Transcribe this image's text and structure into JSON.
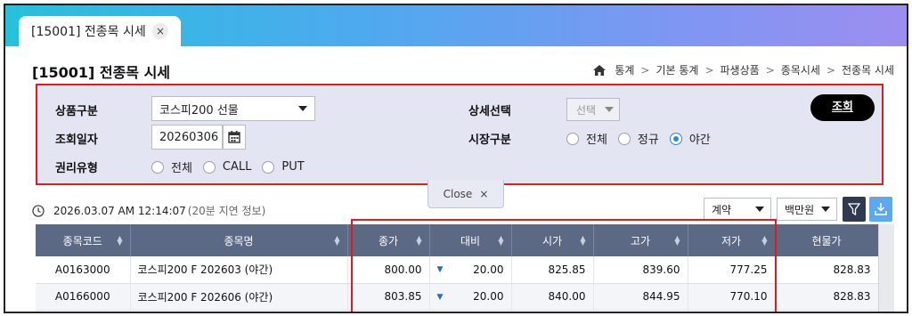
{
  "tab": {
    "label": "[15001] 전종목 시세",
    "close": "×"
  },
  "page": {
    "title": "[15001] 전종목 시세"
  },
  "breadcrumb": [
    "통계",
    "기본 통계",
    "파생상품",
    "종목시세",
    "전종목 시세"
  ],
  "search": {
    "product_label": "상품구분",
    "product_value": "코스피200 선물",
    "date_label": "조회일자",
    "date_value": "20260306",
    "right_label": "권리유형",
    "right_options": [
      "전체",
      "CALL",
      "PUT"
    ],
    "detail_label": "상세선택",
    "detail_value": "선택",
    "market_label": "시장구분",
    "market_options": [
      "전체",
      "정규",
      "야간"
    ],
    "market_selected": "야간",
    "button": "조회"
  },
  "close_panel": {
    "label": "Close",
    "icon": "×"
  },
  "status": {
    "time": "2026.03.07 AM 12:14:07",
    "note": "(20분 지연 정보)"
  },
  "controls": {
    "sort_select": "계약",
    "unit_select": "백만원"
  },
  "icons": {
    "filter": "filter-icon",
    "download": "download-icon",
    "calendar": "calendar-icon",
    "clock": "clock-icon",
    "home": "home-icon"
  },
  "colors": {
    "accent": "#2f87d8",
    "header": "#5c6985",
    "highlight": "#e31a1a",
    "change": "#1f6fc8"
  },
  "table": {
    "headers": [
      "종목코드",
      "종목명",
      "종가",
      "대비",
      "시가",
      "고가",
      "저가",
      "현물가"
    ],
    "rows": [
      [
        "A0163000",
        "코스피200 F 202603 (야간)",
        "800.00",
        "20.00",
        "825.85",
        "839.60",
        "777.25",
        "828.83"
      ],
      [
        "A0166000",
        "코스피200 F 202606 (야간)",
        "803.85",
        "20.00",
        "840.00",
        "844.95",
        "770.10",
        "828.83"
      ]
    ],
    "change_direction": "▼"
  }
}
